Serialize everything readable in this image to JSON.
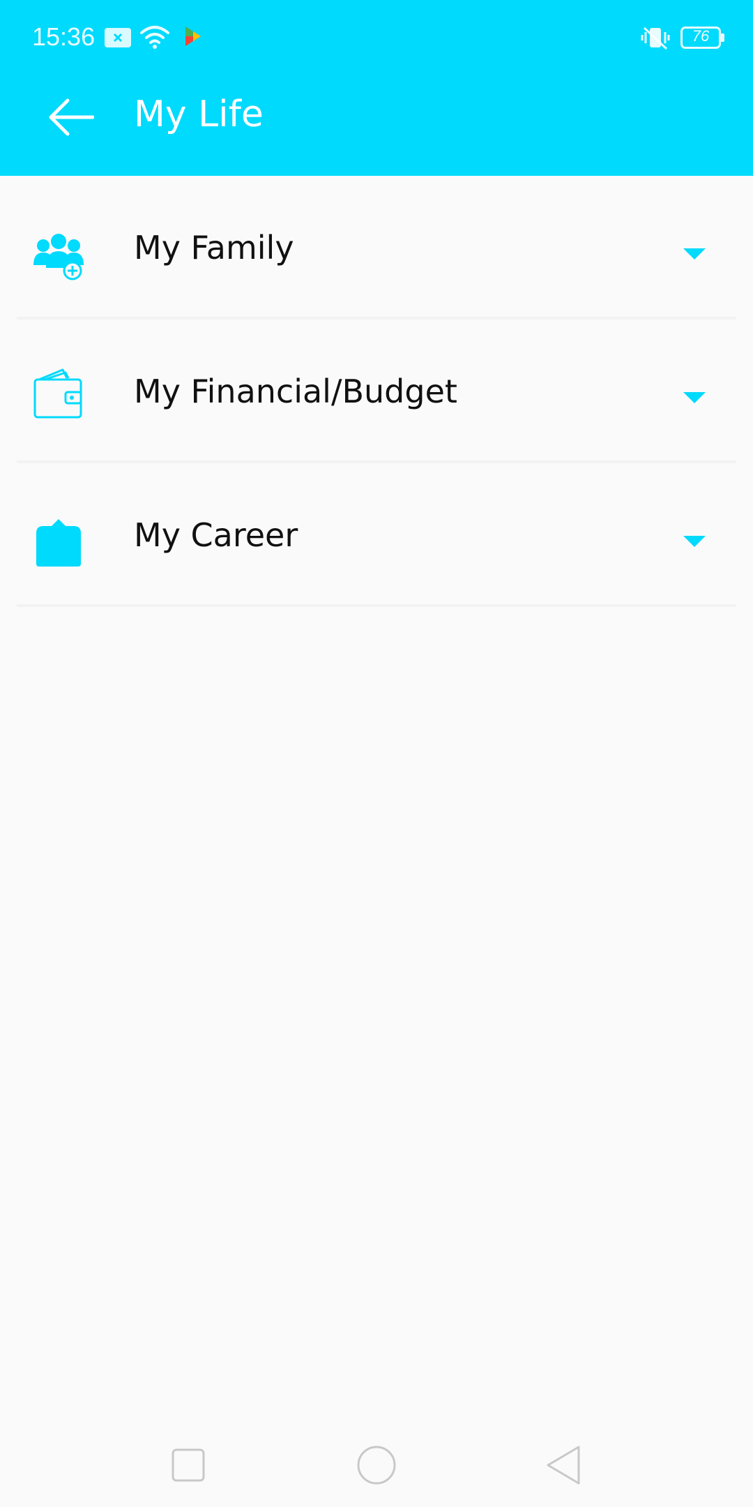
{
  "status_bar": {
    "time": "15:36",
    "battery_level": "76",
    "icons": [
      "notification-x-icon",
      "wifi-icon",
      "play-store-icon",
      "vibrate-icon",
      "battery-icon"
    ]
  },
  "toolbar": {
    "title": "My Life",
    "back_icon": "arrow-left-icon"
  },
  "colors": {
    "accent": "#00dafd",
    "background": "#fafafa",
    "text": "#111111"
  },
  "list": {
    "items": [
      {
        "label": "My Family",
        "icon": "family-add-icon",
        "expand_icon": "chevron-down-icon"
      },
      {
        "label": "My Financial/Budget",
        "icon": "wallet-icon",
        "expand_icon": "chevron-down-icon"
      },
      {
        "label": "My Career",
        "icon": "career-icon",
        "expand_icon": "chevron-down-icon"
      }
    ]
  },
  "nav_bar": {
    "icons": [
      "recents-square-icon",
      "home-circle-icon",
      "back-triangle-icon"
    ]
  }
}
